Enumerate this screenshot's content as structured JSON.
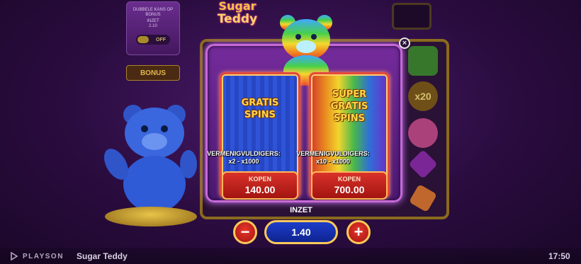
{
  "background_game": {
    "bet_panel": {
      "title": "DUBBELE KANS OP BONUS",
      "bet_label": "INZET",
      "bet_value": "2.10",
      "toggle_label": "OFF"
    },
    "buy_bonus_label": "BONUS",
    "logo_line1": "Sugar",
    "logo_line2": "Teddy",
    "multiplier_symbol": "x20"
  },
  "dialog": {
    "options": [
      {
        "title_line1": "GRATIS",
        "title_line2": "SPINS",
        "title_line3": "",
        "multiplier_label": "VERMENIGVULDIGERS:",
        "multiplier_range": "x2 - x1000",
        "buy_label": "KOPEN",
        "price": "140.00"
      },
      {
        "title_line1": "SUPER",
        "title_line2": "GRATIS",
        "title_line3": "SPINS",
        "multiplier_label": "VERMENIGVULDIGERS:",
        "multiplier_range": "x10 - x1000",
        "buy_label": "KOPEN",
        "price": "700.00"
      }
    ],
    "close_glyph": "×"
  },
  "bet_control": {
    "label": "INZET",
    "value": "1.40",
    "minus_glyph": "−",
    "plus_glyph": "+"
  },
  "footer": {
    "provider": "PLAYSON",
    "game_name": "Sugar Teddy",
    "time": "17:50"
  },
  "colors": {
    "accent_red": "#d9322a",
    "accent_gold": "#ffc95a",
    "dialog_purple": "#742b9b",
    "bet_blue": "#1d3cc9"
  }
}
